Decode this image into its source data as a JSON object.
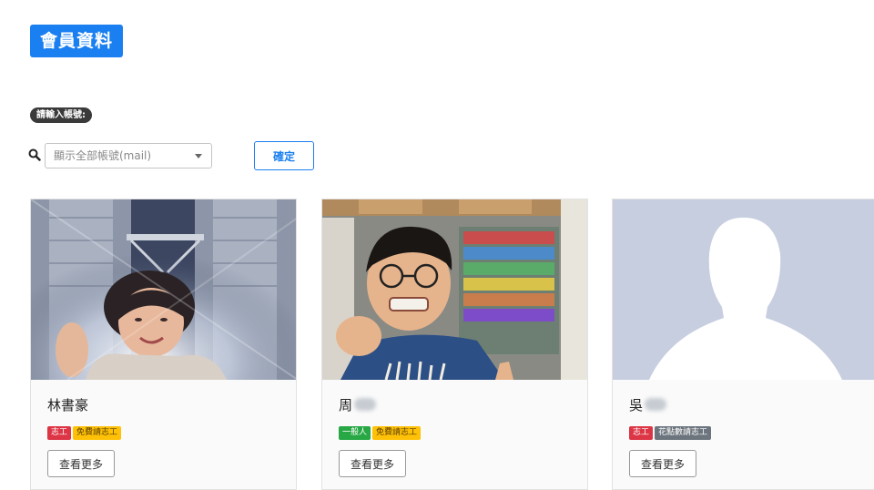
{
  "header": {
    "title": "會員資料"
  },
  "search": {
    "prompt": "請輸入帳號:",
    "placeholder": "顯示全部帳號(mail)",
    "confirm_label": "確定"
  },
  "colors": {
    "primary": "#1a7ff0",
    "tag_red": "#dc3545",
    "tag_yellow": "#ffc107",
    "tag_green": "#28a745",
    "tag_gray": "#6c757d",
    "avatar_bg": "#c7cee0"
  },
  "members": [
    {
      "name": "林書豪",
      "name_obscured": false,
      "tags": [
        {
          "label": "志工",
          "color": "red"
        },
        {
          "label": "免費請志工",
          "color": "yellow"
        }
      ],
      "more_label": "查看更多",
      "photo": "tower-selfie-photo"
    },
    {
      "name": "周",
      "name_obscured": true,
      "tags": [
        {
          "label": "一般人",
          "color": "green"
        },
        {
          "label": "免費請志工",
          "color": "yellow"
        }
      ],
      "more_label": "查看更多",
      "photo": "shop-selfie-photo"
    },
    {
      "name": "吳",
      "name_obscured": true,
      "tags": [
        {
          "label": "志工",
          "color": "red"
        },
        {
          "label": "花點數請志工",
          "color": "gray"
        }
      ],
      "more_label": "查看更多",
      "photo": "default-avatar-icon"
    }
  ]
}
